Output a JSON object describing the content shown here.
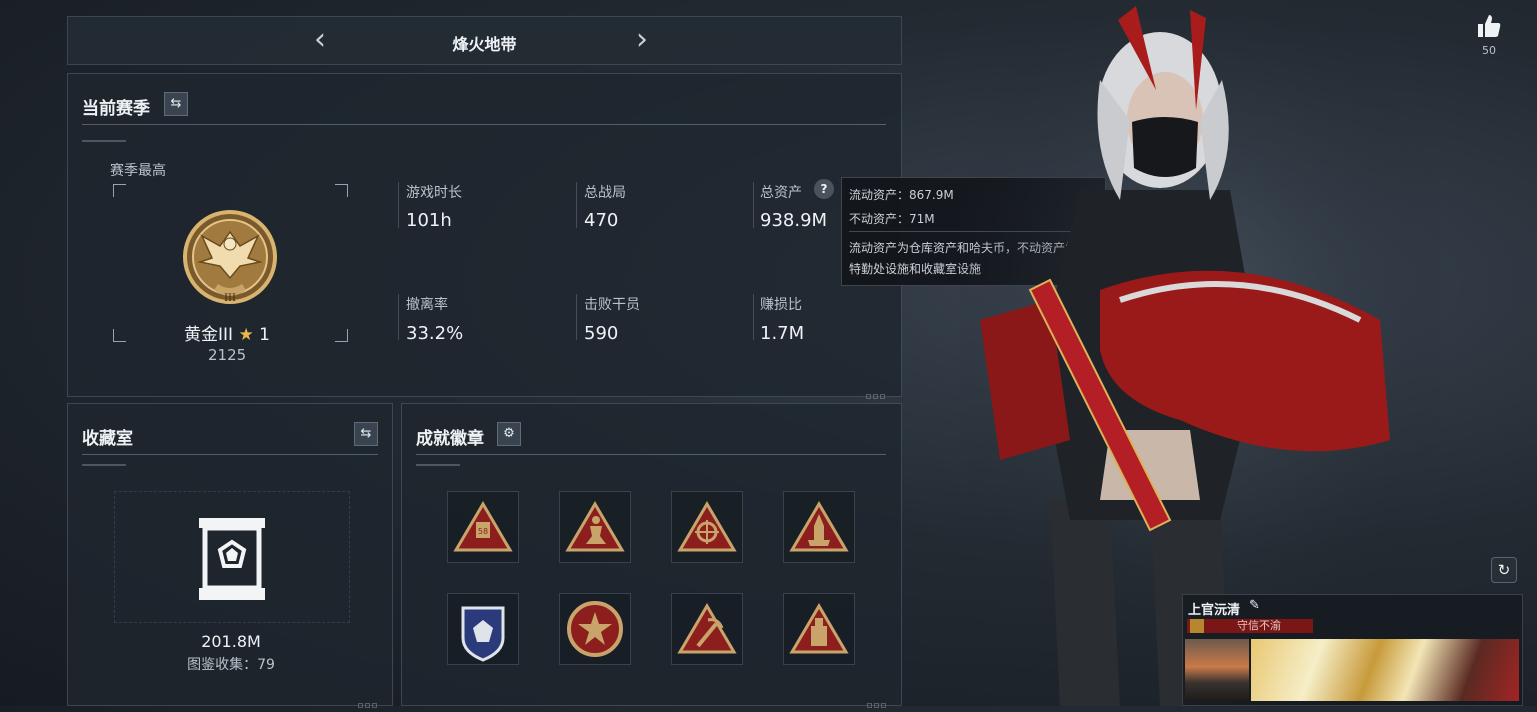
{
  "header": {
    "mode_title": "烽火地带"
  },
  "season": {
    "title": "当前赛季",
    "best_label": "赛季最高",
    "rank_name": "黄金III",
    "rank_stars": "1",
    "rank_score": "2125",
    "rank_roman": "III",
    "stats": [
      {
        "label": "游戏时长",
        "value": "101h"
      },
      {
        "label": "总战局",
        "value": "470"
      },
      {
        "label": "总资产",
        "value": "938.9M"
      },
      {
        "label": "撤离率",
        "value": "33.2%"
      },
      {
        "label": "击败干员",
        "value": "590"
      },
      {
        "label": "赚损比",
        "value": "1.7M"
      }
    ]
  },
  "tooltip": {
    "liquid": "流动资产：867.9M",
    "fixed": "不动资产：71M",
    "desc_line1": "流动资产为仓库资产和哈夫币，不动资产为",
    "desc_line2": "特勤处设施和收藏室设施"
  },
  "collection": {
    "title": "收藏室",
    "value": "201.8M",
    "count_label": "图鉴收集：79"
  },
  "achievements": {
    "title": "成就徽章",
    "badges": [
      "badge-58",
      "badge-kneel",
      "badge-scope",
      "badge-rocket",
      "badge-shield",
      "badge-star",
      "badge-pickaxe",
      "badge-bottle"
    ],
    "badge_number": "58"
  },
  "likes": {
    "count": "50"
  },
  "player": {
    "name": "上官沅清",
    "title": "守信不渝"
  },
  "colors": {
    "accent_gold": "#e8b64a",
    "badge_red": "#8c1f1e",
    "badge_gold": "#c8a46a",
    "title_red": "#8a1a1a"
  }
}
